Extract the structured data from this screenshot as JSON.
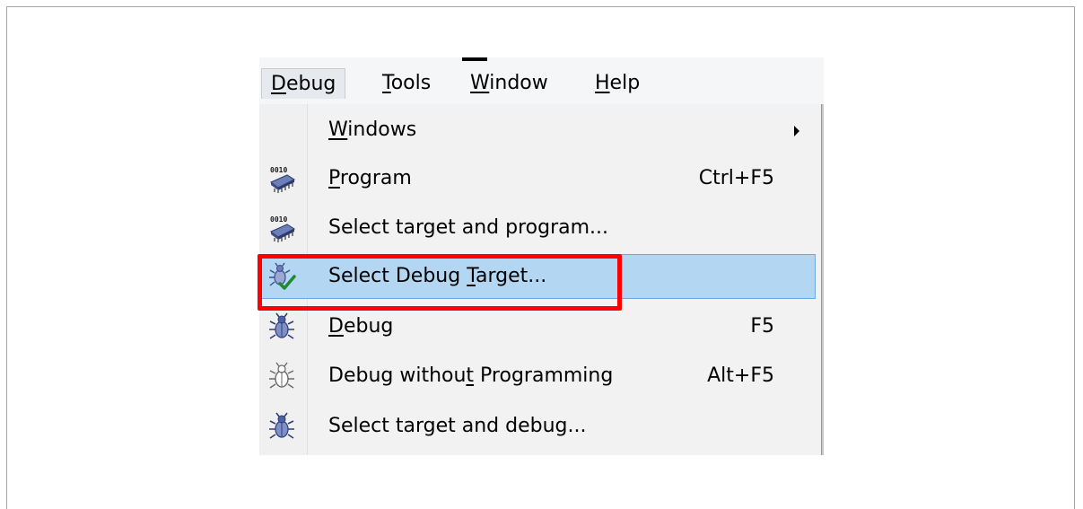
{
  "menubar": {
    "items": [
      {
        "label": "Debug",
        "accel_index": 0,
        "open": true
      },
      {
        "label": "Tools",
        "accel_index": 0,
        "open": false
      },
      {
        "label": "Window",
        "accel_index": 0,
        "open": false
      },
      {
        "label": "Help",
        "accel_index": 0,
        "open": false
      }
    ]
  },
  "dropdown": {
    "items": [
      {
        "label": "Windows",
        "accel_index": 0,
        "shortcut": "",
        "submenu": true,
        "icon": "none"
      },
      {
        "label": "Program",
        "accel_index": 0,
        "shortcut": "Ctrl+F5",
        "submenu": false,
        "icon": "chip-program-icon"
      },
      {
        "label": "Select target and program...",
        "accel_index": -1,
        "shortcut": "",
        "submenu": false,
        "icon": "chip-program-icon"
      },
      {
        "label": "Select Debug Target...",
        "accel_index": 13,
        "shortcut": "",
        "submenu": false,
        "icon": "bug-check-icon",
        "selected": true
      },
      {
        "label": "Debug",
        "accel_index": 0,
        "shortcut": "F5",
        "submenu": false,
        "icon": "bug-icon"
      },
      {
        "label": "Debug without Programming",
        "accel_index": 12,
        "shortcut": "Alt+F5",
        "submenu": false,
        "icon": "bug-outline-icon"
      },
      {
        "label": "Select target and debug...",
        "accel_index": -1,
        "shortcut": "",
        "submenu": false,
        "icon": "bug-icon"
      }
    ]
  },
  "colors": {
    "highlight": "#b3d7f3",
    "highlight_border": "#6fa8dc",
    "annotation": "#ff0000"
  }
}
